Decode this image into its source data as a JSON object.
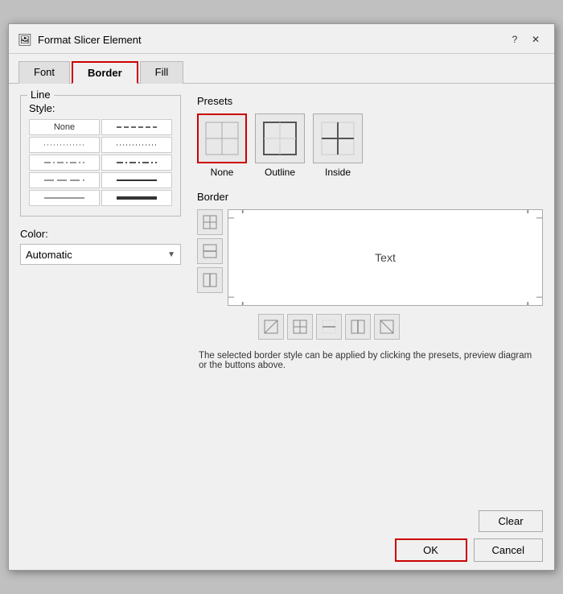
{
  "dialog": {
    "title": "Format Slicer Element",
    "help_label": "?",
    "close_label": "✕"
  },
  "tabs": [
    {
      "id": "font",
      "label": "Font"
    },
    {
      "id": "border",
      "label": "Border",
      "active": true
    },
    {
      "id": "fill",
      "label": "Fill"
    }
  ],
  "line_group": {
    "label": "Line",
    "style_label": "Style:",
    "none_label": "None",
    "styles": [
      "dash1",
      "dot1",
      "dashdot",
      "dash2",
      "solid-thin",
      "solid-thick"
    ]
  },
  "color_group": {
    "label": "Color:",
    "value": "Automatic"
  },
  "presets": {
    "label": "Presets",
    "items": [
      {
        "id": "none",
        "label": "None",
        "selected": true
      },
      {
        "id": "outline",
        "label": "Outline"
      },
      {
        "id": "inside",
        "label": "Inside"
      }
    ]
  },
  "border_section": {
    "label": "Border",
    "preview_text": "Text"
  },
  "hint_text": "The selected border style can be applied by clicking the presets, preview diagram or the buttons above.",
  "footer": {
    "clear_label": "Clear",
    "ok_label": "OK",
    "cancel_label": "Cancel"
  }
}
